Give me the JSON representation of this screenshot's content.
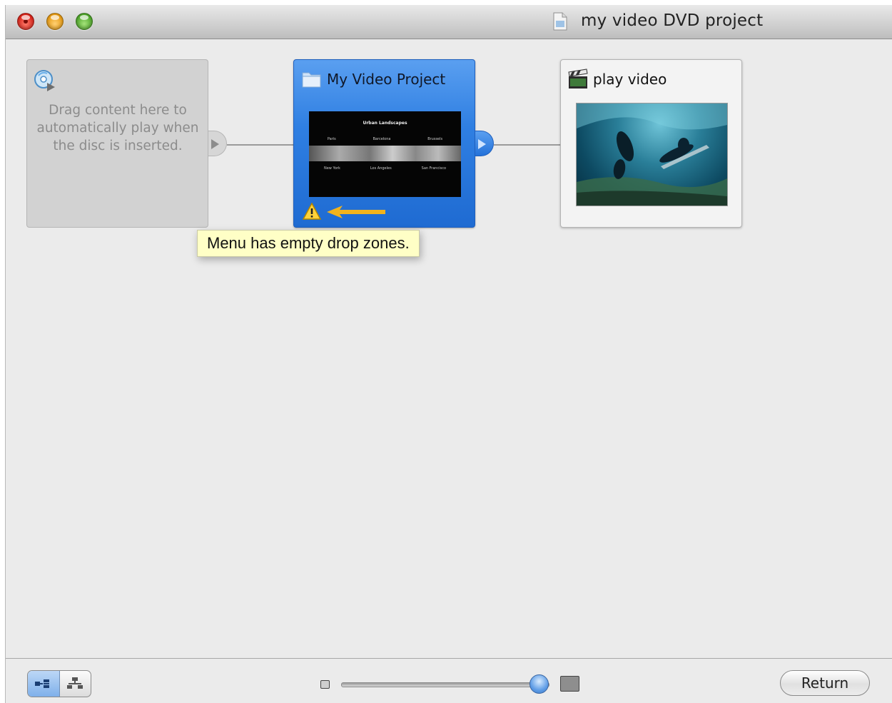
{
  "window": {
    "title": "my video DVD project"
  },
  "autoplay": {
    "text": "Drag content here to automatically play when the disc is inserted.",
    "icon": "disc-autoplay-icon"
  },
  "menu": {
    "title": "My Video Project",
    "icon": "folder-icon",
    "thumbnail": {
      "heading": "Urban Landscapes",
      "row1": [
        "Paris",
        "Barcelona",
        "Brussels"
      ],
      "row2": [
        "New York",
        "Los Angeles",
        "San Francisco"
      ]
    },
    "warning_icon": "warning-icon"
  },
  "tooltip": {
    "text": "Menu has empty drop zones."
  },
  "video": {
    "title": "play video",
    "icon": "clapperboard-icon"
  },
  "bottom": {
    "view_modes": [
      "flow-view",
      "tree-view"
    ],
    "active_view": "flow-view",
    "zoom_level": 0.95,
    "return_label": "Return"
  },
  "colors": {
    "selected_card": "#2f7fe2",
    "tooltip_bg": "#ffffc6",
    "warning_arrow": "#f2b31c"
  }
}
